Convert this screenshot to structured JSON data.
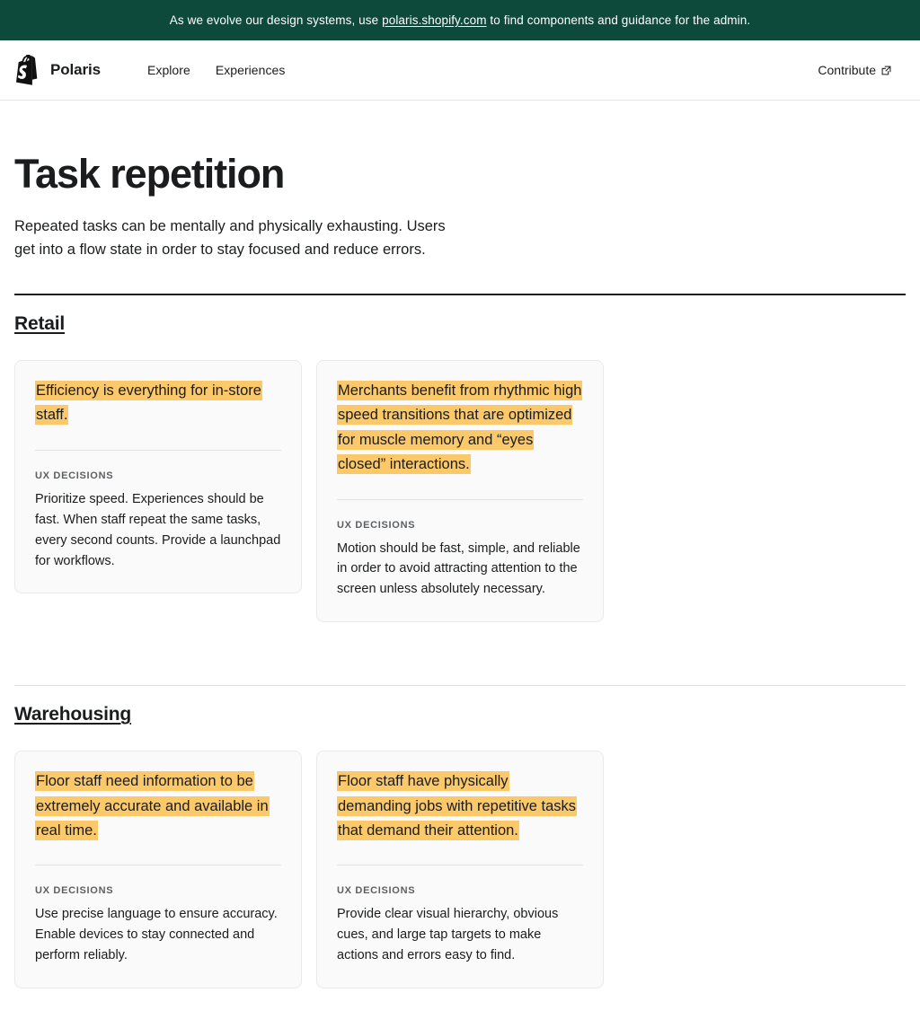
{
  "announcement": {
    "text_before": "As we evolve our design systems, use ",
    "link_text": "polaris.shopify.com",
    "text_after": " to find components and guidance for the admin.",
    "background_color": "#0e4a3c"
  },
  "topnav": {
    "logo_icon": "shopify-bag-icon",
    "brand_name": "Polaris",
    "links": [
      {
        "label": "Explore"
      },
      {
        "label": "Experiences"
      }
    ],
    "contribute": {
      "label": "Contribute",
      "icon": "external-link-icon"
    }
  },
  "page": {
    "title": "Task repetition",
    "intro": "Repeated tasks can be mentally and physically exhausting. Users get into a flow state in order to stay focused and reduce errors."
  },
  "sections": [
    {
      "heading": "Retail",
      "rule_style": "dark",
      "cards": [
        {
          "quote": "Efficiency is everything for in-store staff.",
          "label": "UX DECISIONS",
          "body": "Prioritize speed. Experiences should be fast. When staff repeat the same tasks, every second counts. Provide a launchpad for workflows."
        },
        {
          "quote": "Merchants benefit from rhythmic high speed transitions that are optimized for muscle memory and “eyes closed” interactions.",
          "label": "UX DECISIONS",
          "body": "Motion should be fast, simple, and reliable in order to avoid attracting attention to the screen unless absolutely necessary."
        }
      ]
    },
    {
      "heading": "Warehousing",
      "rule_style": "light",
      "cards": [
        {
          "quote": "Floor staff need information to be extremely accurate and available in real time.",
          "label": "UX DECISIONS",
          "body": "Use precise language to ensure accuracy. Enable devices to stay connected and perform reliably."
        },
        {
          "quote": "Floor staff have physically demanding jobs with repetitive tasks that demand their attention.",
          "label": "UX DECISIONS",
          "body": "Provide clear visual hierarchy, obvious cues, and large tap targets to make actions and errors easy to find."
        }
      ]
    }
  ],
  "colors": {
    "highlight": "#fbc96a",
    "banner_green": "#0e4a3c",
    "card_background": "#fafafa",
    "text": "#1a1c1d",
    "muted_text": "#5c5f62"
  }
}
